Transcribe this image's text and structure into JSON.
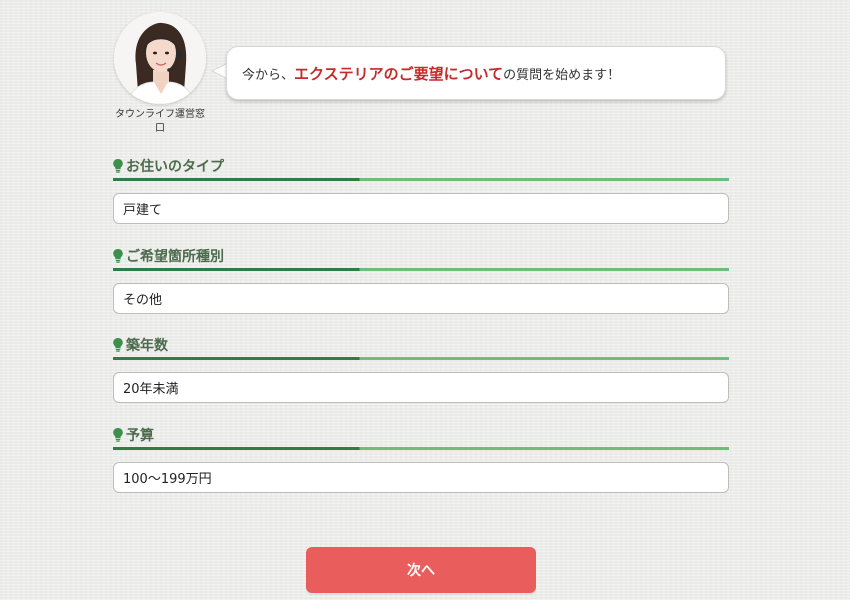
{
  "operator": {
    "name": "タウンライフ運営窓口"
  },
  "intro": {
    "prefix": "今から、",
    "highlight": "エクステリアのご要望について",
    "suffix": "の質問を始めます！"
  },
  "questions": [
    {
      "label": "お住いのタイプ",
      "answer": "戸建て"
    },
    {
      "label": "ご希望箇所種別",
      "answer": "その他"
    },
    {
      "label": "築年数",
      "answer": "20年未満"
    },
    {
      "label": "予算",
      "answer": "100〜199万円"
    }
  ],
  "next_button": {
    "label": "次へ"
  },
  "colors": {
    "accent_red": "#c62a2a",
    "button_red": "#e95d5d",
    "title_green": "#4c6b4c",
    "rule_dark_green": "#2e7d46",
    "rule_light_green": "#6fbc7c"
  },
  "icons": {
    "section_title": "lightbulb-icon"
  }
}
